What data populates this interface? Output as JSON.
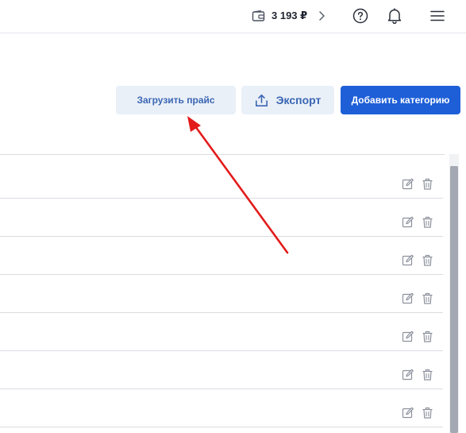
{
  "header": {
    "balance": "3 193 ₽",
    "icons": [
      "wallet-icon",
      "chevron-right-icon",
      "help-icon",
      "bell-icon",
      "menu-icon"
    ]
  },
  "toolbar": {
    "upload_label": "Загрузить прайс",
    "export_label": "Экспорт",
    "add_category_label": "Добавить категорию"
  },
  "table": {
    "row_count": 7,
    "row_icons": [
      "edit-icon",
      "trash-icon"
    ]
  },
  "colors": {
    "primary": "#1e5fd8",
    "secondary_bg": "#eaf0f8",
    "secondary_text": "#3a66b3",
    "annotation_arrow": "#e31b1b"
  }
}
